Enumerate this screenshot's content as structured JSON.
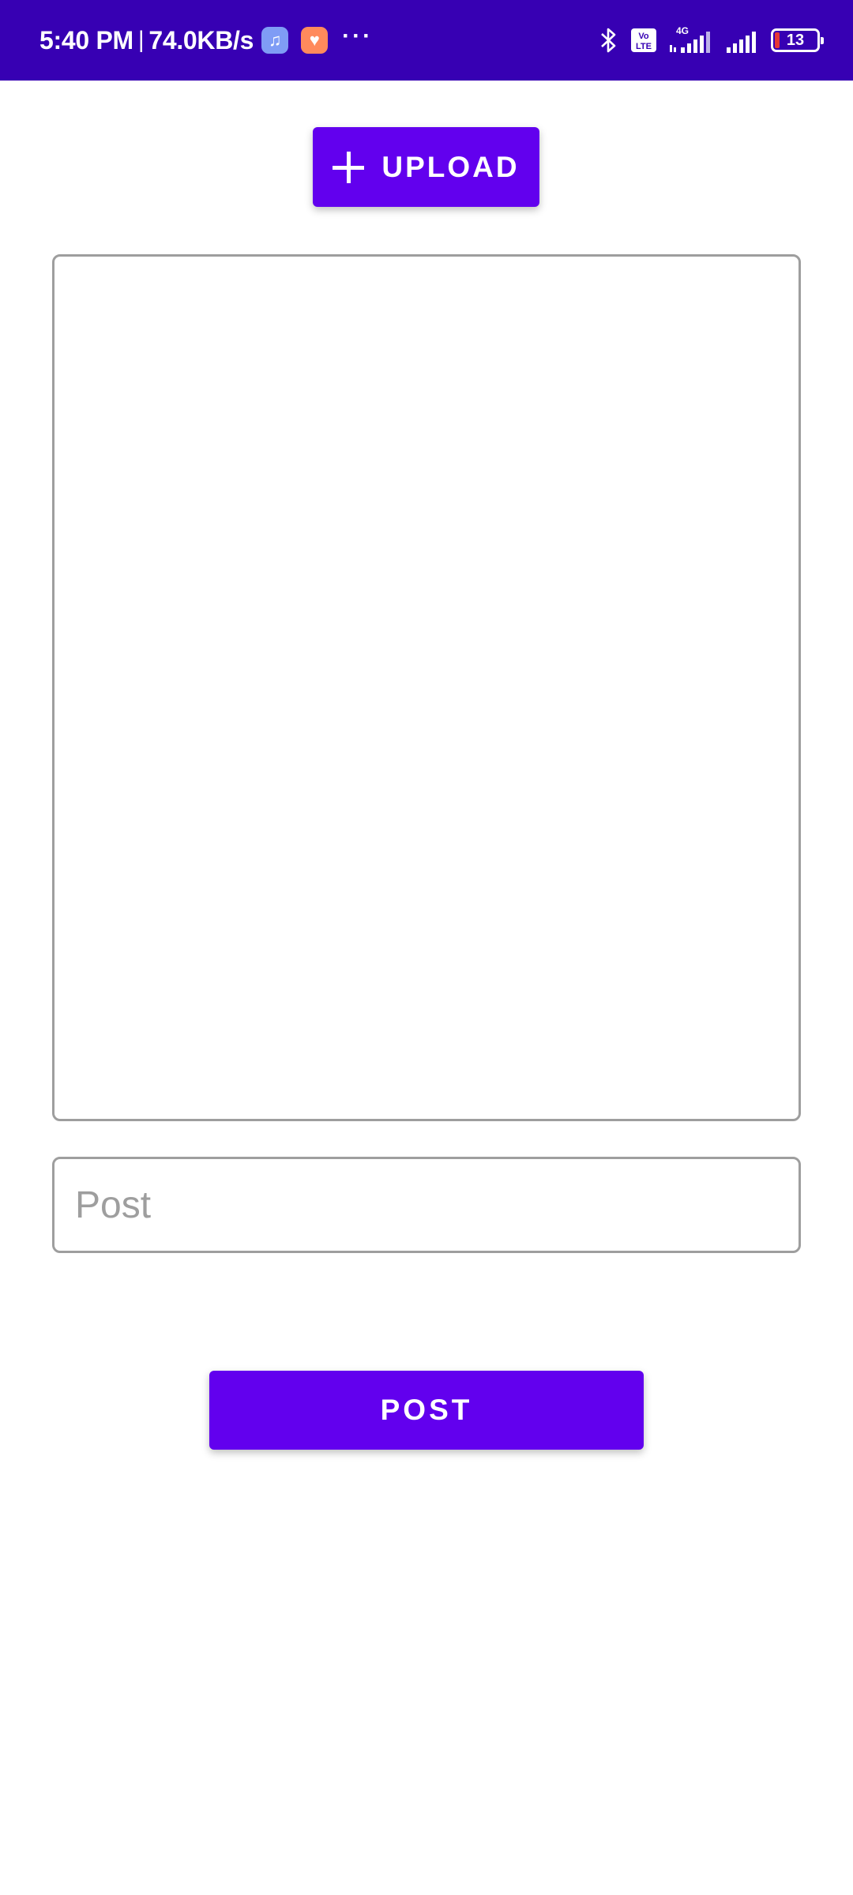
{
  "status_bar": {
    "time": "5:40 PM",
    "separator": "|",
    "network_speed": "74.0KB/s",
    "notification_icons": [
      "music-icon",
      "health-icon"
    ],
    "more": "···",
    "network_type": "4G",
    "volte": "Vo LTE",
    "battery_level": "13",
    "background_color": "#3700b3"
  },
  "actions": {
    "upload_label": "UPLOAD",
    "post_label": "POST",
    "accent_color": "#6200ee"
  },
  "post_input": {
    "placeholder": "Post",
    "value": ""
  }
}
